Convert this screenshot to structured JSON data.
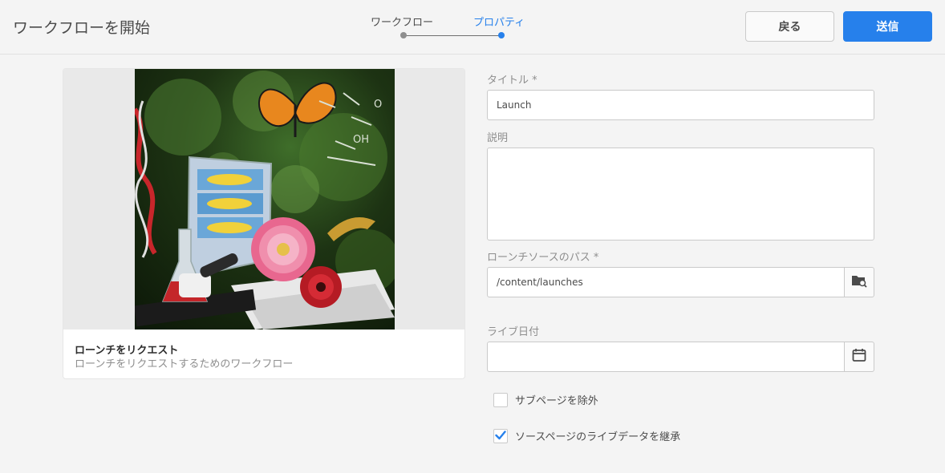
{
  "header": {
    "title": "ワークフローを開始",
    "steps": [
      {
        "label": "ワークフロー",
        "state": "completed"
      },
      {
        "label": "プロパティ",
        "state": "active"
      }
    ],
    "back_label": "戻る",
    "submit_label": "送信"
  },
  "colors": {
    "accent": "#2680eb",
    "background": "#f4f4f4"
  },
  "workflow_card": {
    "title": "ローンチをリクエスト",
    "description": "ローンチをリクエストするためのワークフロー"
  },
  "form": {
    "title_label": "タイトル *",
    "title_value": "Launch",
    "description_label": "説明",
    "description_value": "",
    "source_path_label": "ローンチソースのパス *",
    "source_path_value": "/content/launches",
    "live_date_label": "ライブ日付",
    "live_date_value": "",
    "exclude_subpages_label": "サブページを除外",
    "exclude_subpages_checked": false,
    "inherit_live_data_label": "ソースページのライブデータを継承",
    "inherit_live_data_checked": true
  }
}
